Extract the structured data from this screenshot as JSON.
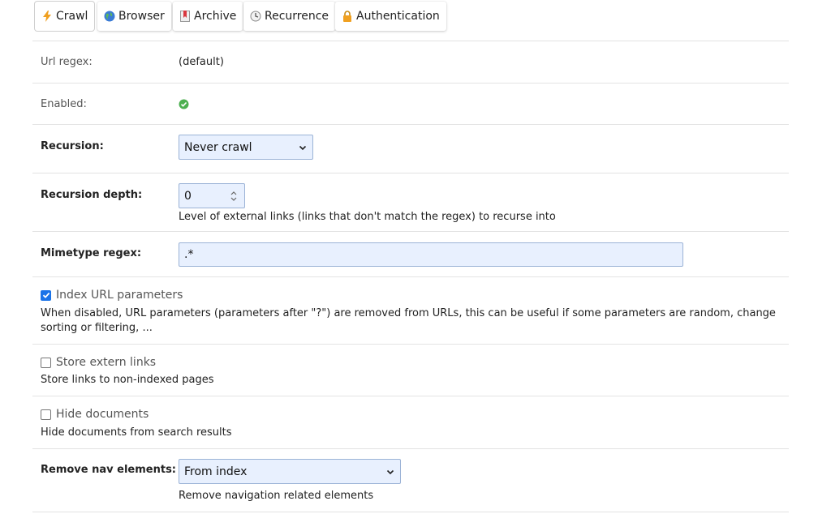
{
  "tabs": [
    {
      "label": "Crawl",
      "icon": "lightning-icon",
      "active": true
    },
    {
      "label": "Browser",
      "icon": "globe-icon"
    },
    {
      "label": "Archive",
      "icon": "bookmark-icon"
    },
    {
      "label": "Recurrence",
      "icon": "clock-icon"
    },
    {
      "label": "Authentication",
      "icon": "lock-icon"
    }
  ],
  "url_regex": {
    "label": "Url regex:",
    "value": "(default)"
  },
  "enabled": {
    "label": "Enabled:",
    "icon": "check-circle-icon",
    "color": "#4caf50"
  },
  "recursion": {
    "label": "Recursion:",
    "selected": "Never crawl"
  },
  "recursion_depth": {
    "label": "Recursion depth:",
    "value": "0",
    "help": "Level of external links (links that don't match the regex) to recurse into"
  },
  "mimetype_regex": {
    "label": "Mimetype regex:",
    "value": ".*"
  },
  "index_url_params": {
    "label": "Index URL parameters",
    "checked": true,
    "help": "When disabled, URL parameters (parameters after \"?\") are removed from URLs, this can be useful if some parameters are random, change sorting or filtering, ..."
  },
  "store_extern_links": {
    "label": "Store extern links",
    "checked": false,
    "help": "Store links to non-indexed pages"
  },
  "hide_documents": {
    "label": "Hide documents",
    "checked": false,
    "help": "Hide documents from search results"
  },
  "remove_nav": {
    "label": "Remove nav elements:",
    "selected": "From index",
    "help": "Remove navigation related elements"
  },
  "colors": {
    "accent": "#1a73e8",
    "field_bg": "#e8f0fe",
    "border": "#e3e3e3"
  }
}
